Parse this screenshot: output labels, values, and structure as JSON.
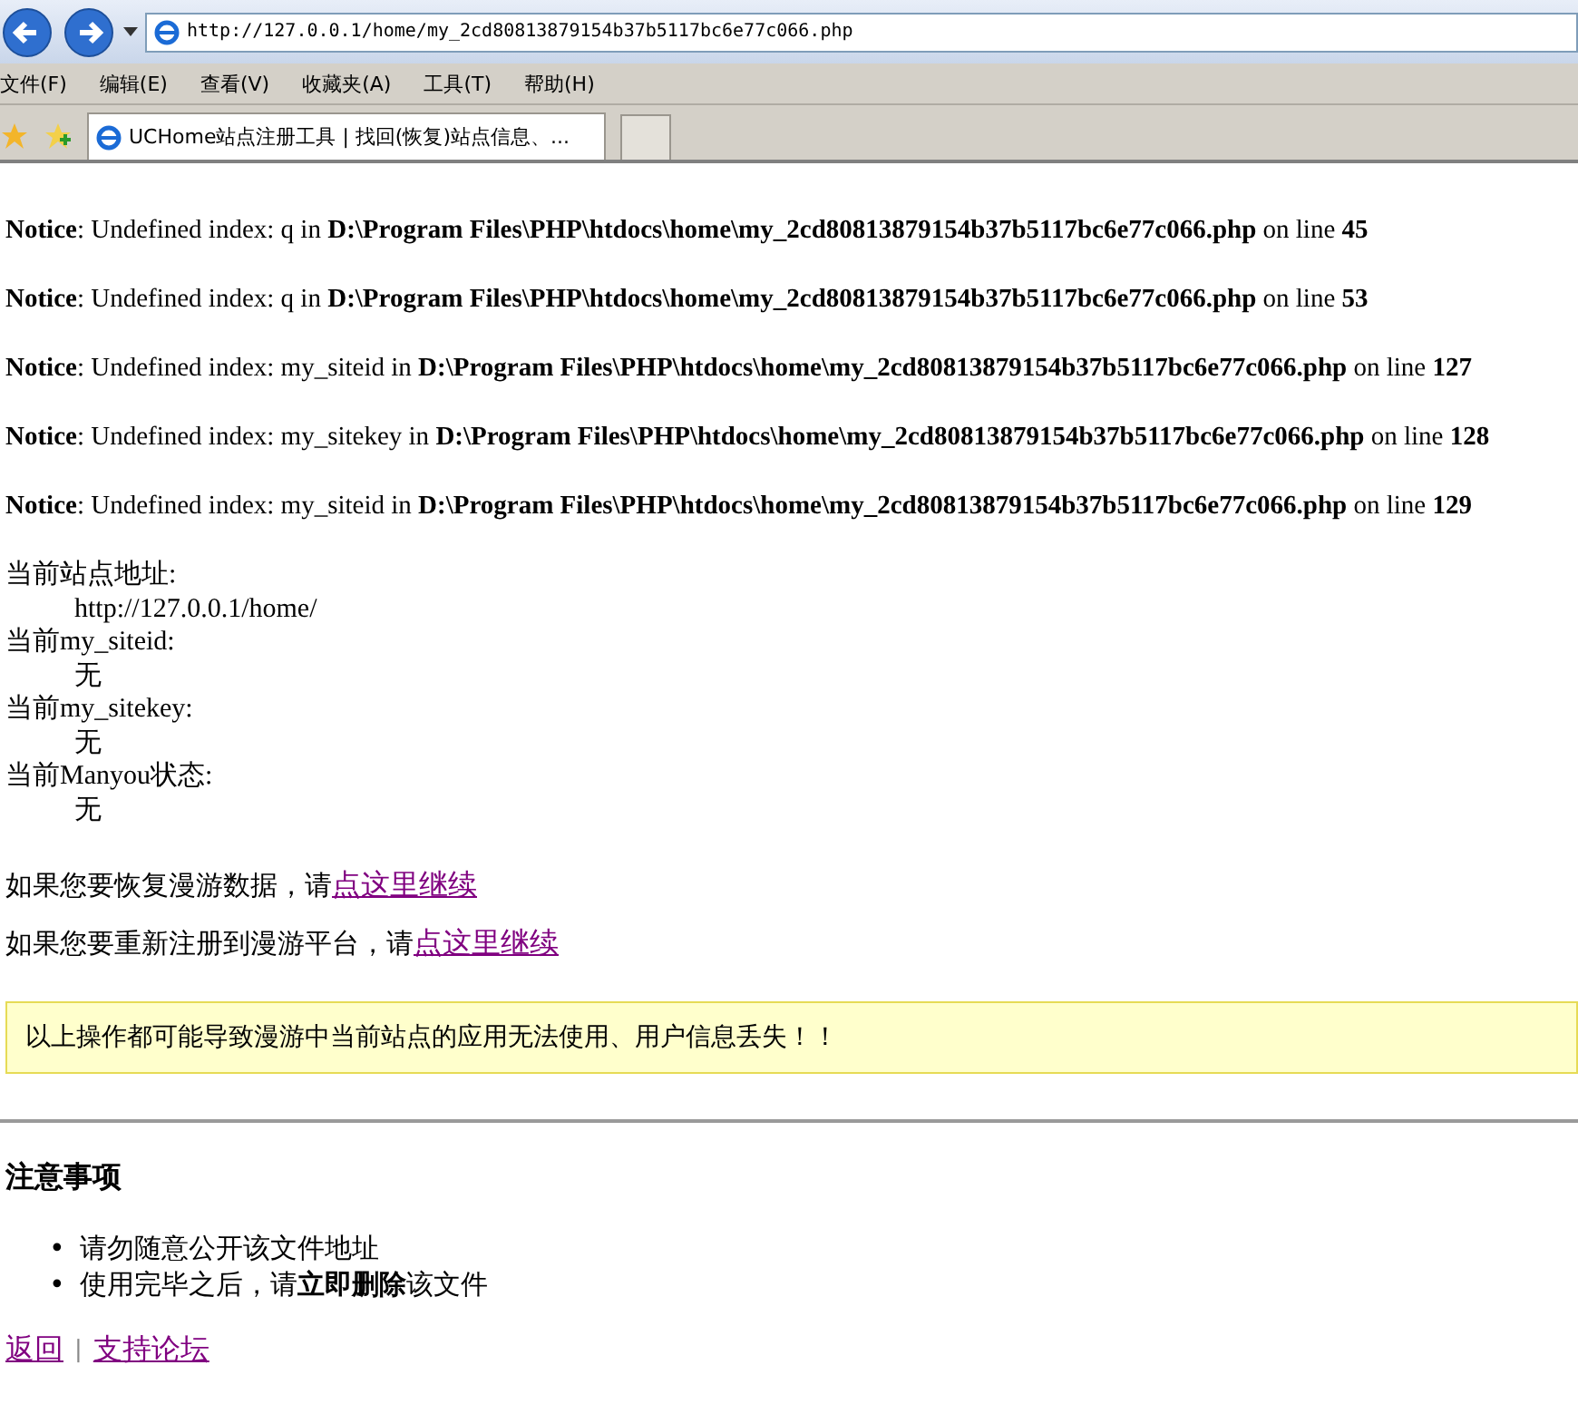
{
  "browser": {
    "address": "http://127.0.0.1/home/my_2cd80813879154b37b5117bc6e77c066.php",
    "menu": [
      "文件(F)",
      "编辑(E)",
      "查看(V)",
      "收藏夹(A)",
      "工具(T)",
      "帮助(H)"
    ],
    "tabs": [
      {
        "title": "UCHome站点注册工具 | 找回(恢复)站点信息、...",
        "selected": true
      }
    ]
  },
  "notices": [
    "**Notice**: Undefined index: q in **D:\\Program Files\\PHP\\htdocs\\home\\my_2cd80813879154b37b5117bc6e77c066.php** on line **45**",
    "**Notice**: Undefined index: q in **D:\\Program Files\\PHP\\htdocs\\home\\my_2cd80813879154b37b5117bc6e77c066.php** on line **53**",
    "**Notice**: Undefined index: my_siteid in **D:\\Program Files\\PHP\\htdocs\\home\\my_2cd80813879154b37b5117bc6e77c066.php** on line **127**",
    "**Notice**: Undefined index: my_sitekey in **D:\\Program Files\\PHP\\htdocs\\home\\my_2cd80813879154b37b5117bc6e77c066.php** on line **128**",
    "**Notice**: Undefined index: my_siteid in **D:\\Program Files\\PHP\\htdocs\\home\\my_2cd80813879154b37b5117bc6e77c066.php** on line **129**"
  ],
  "fields": [
    {
      "label": "当前站点地址:",
      "value": "http://127.0.0.1/home/"
    },
    {
      "label": "当前my_siteid:",
      "value": "无"
    },
    {
      "label": "当前my_sitekey:",
      "value": "无"
    },
    {
      "label": "当前Manyou状态:",
      "value": "无"
    }
  ],
  "actions": [
    {
      "text": "如果您要恢复漫游数据，请",
      "link": "点这里继续"
    },
    {
      "text": "如果您要重新注册到漫游平台，请",
      "link": "点这里继续"
    }
  ],
  "warning": "以上操作都可能导致漫游中当前站点的应用无法使用、用户信息丢失！！",
  "notes": {
    "title": "注意事项",
    "items": [
      {
        "bullet": "•",
        "text": "请勿随意公开该文件地址"
      },
      {
        "bullet": "•",
        "text": "使用完毕之后，请**立即删除**该文件"
      }
    ]
  },
  "footer": {
    "links": [
      "返回",
      "支持论坛"
    ],
    "separator": "|"
  }
}
